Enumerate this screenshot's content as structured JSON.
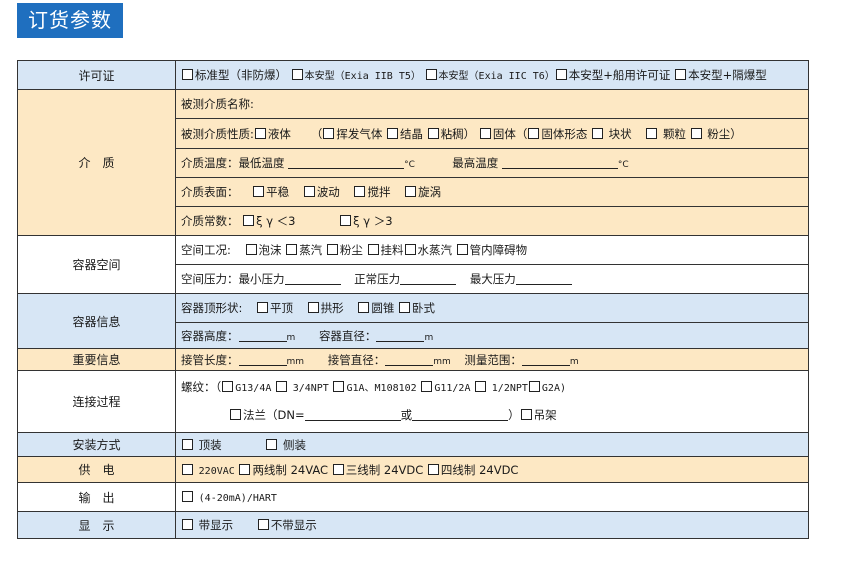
{
  "title": "订货参数",
  "rows": {
    "license": {
      "label": "许可证",
      "options": [
        "标准型（非防爆）",
        "本安型（Exia IIB T5）",
        "本安型（Exia IIC T6）",
        "本安型+船用许可证",
        "本安型+隔爆型"
      ]
    },
    "medium": {
      "label": "介　质",
      "name_label": "被测介质名称:",
      "property_label": "被测介质性质:",
      "property_liquid": "液体",
      "property_open": "（",
      "property_volatile": "挥发气体",
      "property_crystal": "结晶",
      "property_viscous": "粘稠）",
      "property_solid": "固体（",
      "property_solid_form": "固体形态",
      "property_block": "块状",
      "property_granule": "颗粒",
      "property_powder": "粉尘）",
      "temp_label": "介质温度：最低温度",
      "temp_unit": "°C",
      "temp_max_label": "最高温度",
      "temp_max_unit": "°C",
      "surface_label": "介质表面：",
      "surface_options": [
        "平稳",
        "波动",
        "搅拌",
        "旋涡"
      ],
      "const_label": "介质常数：",
      "const_opt1": "ξ γ ＜3",
      "const_opt2": "ξ γ ＞3"
    },
    "vessel_space": {
      "label": "容器空间",
      "condition_label": "空间工况:",
      "condition_options": [
        "泡沫",
        "蒸汽",
        "粉尘",
        "挂料",
        "水蒸汽",
        "管内障碍物"
      ],
      "pressure_label": "空间压力：最小压力",
      "pressure_normal": "正常压力",
      "pressure_max": "最大压力"
    },
    "vessel_info": {
      "label": "容器信息",
      "top_label": "容器顶形状:",
      "top_options": [
        "平顶",
        "拱形",
        "圆锥",
        "卧式"
      ],
      "height_label": "容器高度：",
      "height_unit": "m",
      "diameter_label": "容器直径：",
      "diameter_unit": "m"
    },
    "important": {
      "label": "重要信息",
      "pipe_len_label": "接管长度：",
      "pipe_len_unit": "mm",
      "pipe_dia_label": "接管直径：",
      "pipe_dia_unit": "mm",
      "range_label": "测量范围：",
      "range_unit": "m"
    },
    "connection": {
      "label": "连接过程",
      "thread_label": "螺纹：（",
      "thread_options": [
        "G13/4A",
        "3/4NPT",
        "G1A、M108102",
        "G11/2A",
        "1/2NPT",
        "G2A)"
      ],
      "flange_label": "法兰（DN=",
      "flange_or": "或",
      "flange_close": "）",
      "hanger": "吊架"
    },
    "install": {
      "label": "安装方式",
      "options": [
        "顶装",
        "侧装"
      ]
    },
    "power": {
      "label": "供　电",
      "options": [
        "220VAC",
        "两线制 24VAC",
        "三线制 24VDC",
        "四线制 24VDC"
      ]
    },
    "output": {
      "label": "输　出",
      "option": "(4-20mA)/HART"
    },
    "display": {
      "label": "显　示",
      "options": [
        "带显示",
        "不带显示"
      ]
    }
  }
}
